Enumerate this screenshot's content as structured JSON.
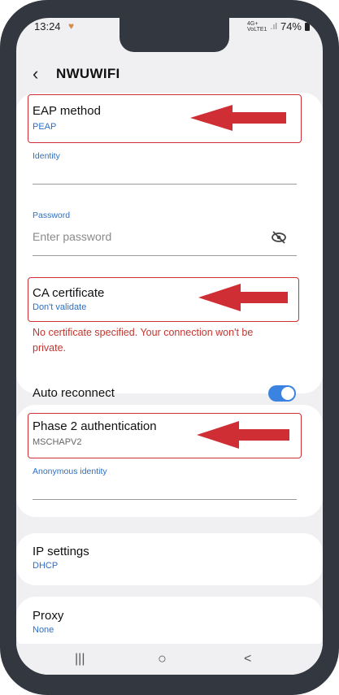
{
  "status": {
    "time": "13:24",
    "battery": "74%",
    "net_line1": "4G+",
    "net_line2": "VoLTE1",
    "signal": ".ıl"
  },
  "header": {
    "title": "NWUWIFI"
  },
  "fields": {
    "eap_method": {
      "label": "EAP method",
      "value": "PEAP"
    },
    "identity": {
      "label": "Identity"
    },
    "password": {
      "label": "Password",
      "placeholder": "Enter password"
    },
    "ca_certificate": {
      "label": "CA certificate",
      "value": "Don't validate"
    },
    "warning": "No certificate specified. Your connection won't be private.",
    "auto_reconnect": {
      "label": "Auto reconnect",
      "on": true
    },
    "phase2": {
      "label": "Phase 2 authentication",
      "value": "MSCHAPV2"
    },
    "anonymous_identity": {
      "label": "Anonymous identity"
    },
    "ip_settings": {
      "label": "IP settings",
      "value": "DHCP"
    },
    "proxy": {
      "label": "Proxy",
      "value": "None"
    }
  },
  "nav": {
    "recents": "|||",
    "home": "○",
    "back": "<"
  },
  "colors": {
    "accent": "#2b6fc6",
    "annotation_red": "#cf2e34",
    "warning": "#c2362f",
    "frame": "#333740"
  }
}
